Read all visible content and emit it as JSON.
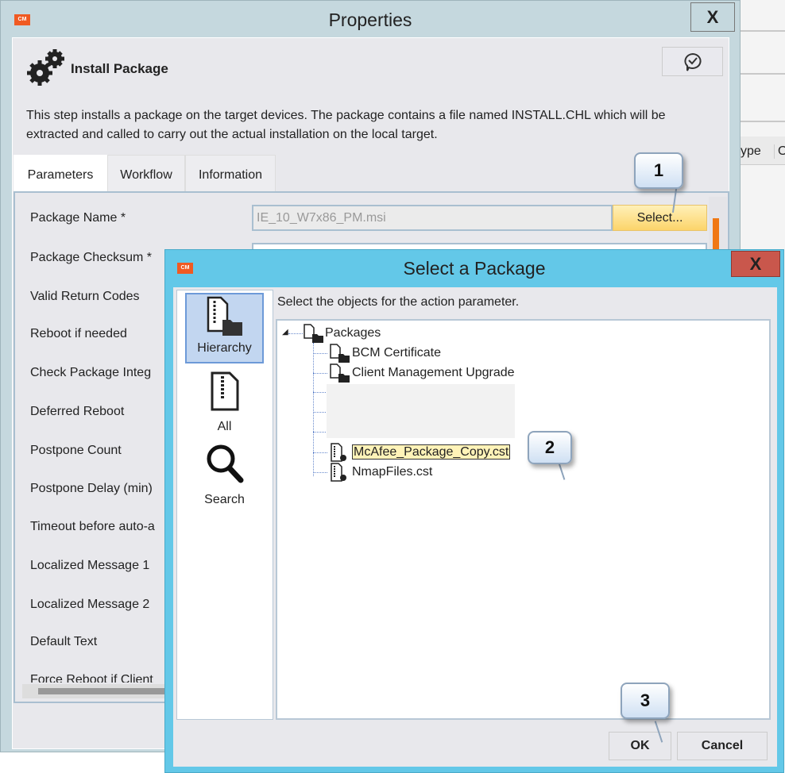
{
  "background": {
    "column_text": "ype",
    "column_text2": "O"
  },
  "properties": {
    "title": "Properties",
    "close": "X",
    "app_badge": "CM",
    "step_title": "Install Package",
    "description": "This step installs a package on the target devices. The package contains a file named INSTALL.CHL which will be extracted and called to carry out the actual installation on the local target.",
    "tabs": [
      {
        "label": "Parameters",
        "active": true
      },
      {
        "label": "Workflow"
      },
      {
        "label": "Information"
      }
    ],
    "params": [
      "Package Name *",
      "Package Checksum *",
      "Valid Return Codes",
      "Reboot if needed",
      "Check Package Integ",
      "Deferred Reboot",
      "Postpone Count",
      "Postpone Delay (min)",
      "Timeout before auto-a",
      "Localized Message 1",
      "Localized Message 2",
      "Default Text",
      "Force Reboot if Client"
    ],
    "package_name_value": "IE_10_W7x86_PM.msi",
    "select_button": "Select..."
  },
  "dialog": {
    "title": "Select a Package",
    "close": "X",
    "app_badge": "CM",
    "nav": [
      {
        "label": "Hierarchy",
        "selected": true
      },
      {
        "label": "All"
      },
      {
        "label": "Search"
      }
    ],
    "hint": "Select the objects for the action parameter.",
    "tree": {
      "root": "Packages",
      "children": [
        "BCM Certificate",
        "Client Management Upgrade",
        "McAfee_Package_Copy.cst",
        "NmapFiles.cst"
      ],
      "selected": "McAfee_Package_Copy.cst"
    },
    "ok": "OK",
    "cancel": "Cancel"
  },
  "callouts": [
    "1",
    "2",
    "3"
  ],
  "colors": {
    "select_button": "#fcd46a",
    "dialog_title": "#63c8e8",
    "dialog_close": "#c9574c",
    "scroll_thumb": "#f07814",
    "selection": "#fff3b8"
  }
}
